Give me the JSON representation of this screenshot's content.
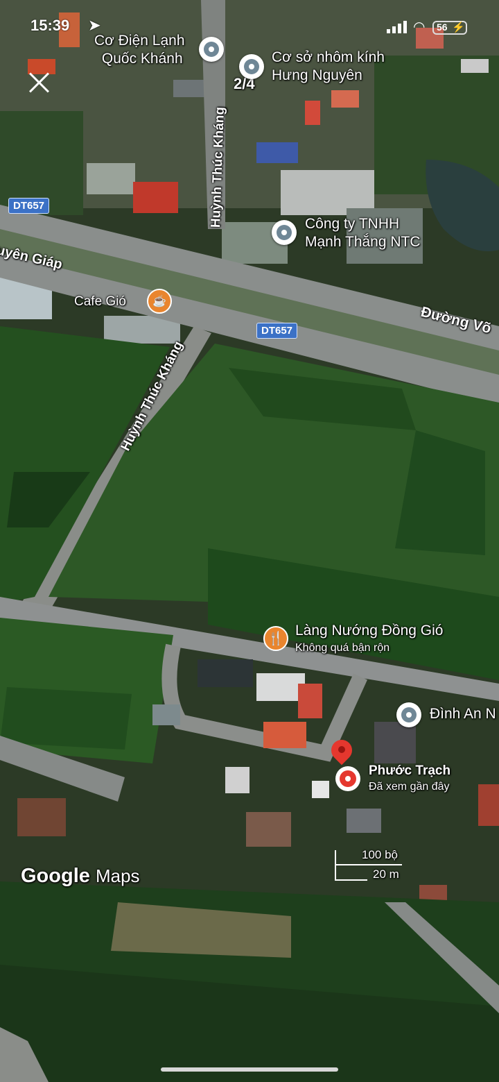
{
  "status_bar": {
    "time": "15:39",
    "battery": "56"
  },
  "viewer": {
    "counter": "2/4"
  },
  "pois": {
    "co_dien_lanh": {
      "line1": "Cơ Điện Lạnh",
      "line2": "Quốc Khánh"
    },
    "co_so_nhom": {
      "line1": "Cơ sở nhôm kính",
      "line2": "Hưng Nguyên"
    },
    "cong_ty": {
      "line1": "Công ty TNHH",
      "line2": "Mạnh Thắng NTC"
    },
    "cafe": {
      "name": "Cafe Gió"
    },
    "lang_nuong": {
      "name": "Làng Nướng Đồng Gió",
      "status": "Không quá bận rộn"
    },
    "dinh": {
      "name": "Đình An N"
    },
    "phuoc_trach": {
      "name": "Phước Trạch",
      "note": "Đã xem gần đây"
    }
  },
  "roads": {
    "dt657_badge_1": "DT657",
    "dt657_badge_2": "DT657",
    "huynh_thuc_khang_1": "Huỳnh Thúc Kháng",
    "huynh_thuc_khang_2": "Huỳnh Thúc Kháng",
    "nguyen_giap": "uyên Giáp",
    "duong_vo": "Đường Võ"
  },
  "scale": {
    "feet": "100 bộ",
    "meters": "20 m"
  },
  "attribution": {
    "brand": "Google",
    "product": "Maps"
  },
  "colors": {
    "field_dark": "#1e3a1c",
    "field_light": "#2e5a27",
    "road": "#8e9090",
    "pin_red": "#e5372e",
    "food_orange": "#e9852e",
    "badge_blue": "#3b71c6"
  }
}
